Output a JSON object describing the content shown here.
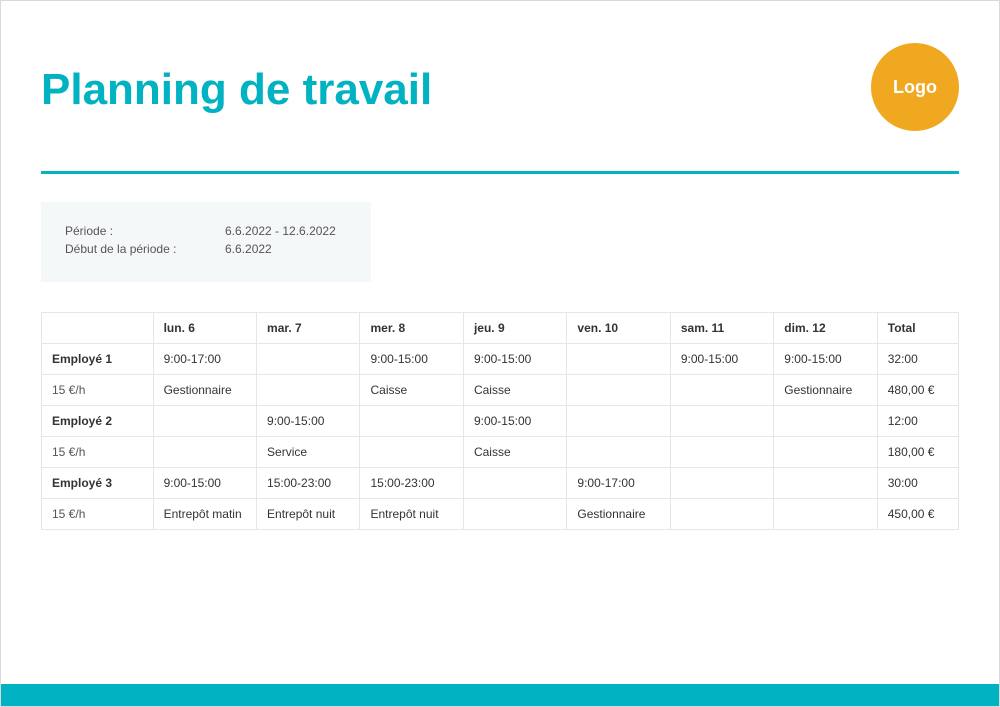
{
  "title": "Planning de travail",
  "logo_text": "Logo",
  "meta": {
    "period_label": "Période :",
    "period_value": "6.6.2022  -  12.6.2022",
    "start_label": "Début de la période :",
    "start_value": "6.6.2022"
  },
  "columns": {
    "name_blank": "",
    "days": [
      "lun. 6",
      "mar. 7",
      "mer. 8",
      "jeu. 9",
      "ven. 10",
      "sam. 11",
      "dim. 12"
    ],
    "total": "Total"
  },
  "employees": [
    {
      "name": "Employé 1",
      "rate": "15 €/h",
      "times": [
        "9:00-17:00",
        "",
        "9:00-15:00",
        "9:00-15:00",
        "",
        "9:00-15:00",
        "9:00-15:00"
      ],
      "roles": [
        "Gestionnaire",
        "",
        "Caisse",
        "Caisse",
        "",
        "",
        "Gestionnaire"
      ],
      "total_time": "32:00",
      "total_pay": "480,00 €"
    },
    {
      "name": "Employé 2",
      "rate": "15 €/h",
      "times": [
        "",
        "9:00-15:00",
        "",
        "9:00-15:00",
        "",
        "",
        ""
      ],
      "roles": [
        "",
        "Service",
        "",
        "Caisse",
        "",
        "",
        ""
      ],
      "total_time": "12:00",
      "total_pay": "180,00 €"
    },
    {
      "name": "Employé 3",
      "rate": "15 €/h",
      "times": [
        "9:00-15:00",
        "15:00-23:00",
        "15:00-23:00",
        "",
        "9:00-17:00",
        "",
        ""
      ],
      "roles": [
        "Entrepôt matin",
        "Entrepôt nuit",
        "Entrepôt nuit",
        "",
        "Gestionnaire",
        "",
        ""
      ],
      "total_time": "30:00",
      "total_pay": "450,00 €"
    }
  ]
}
